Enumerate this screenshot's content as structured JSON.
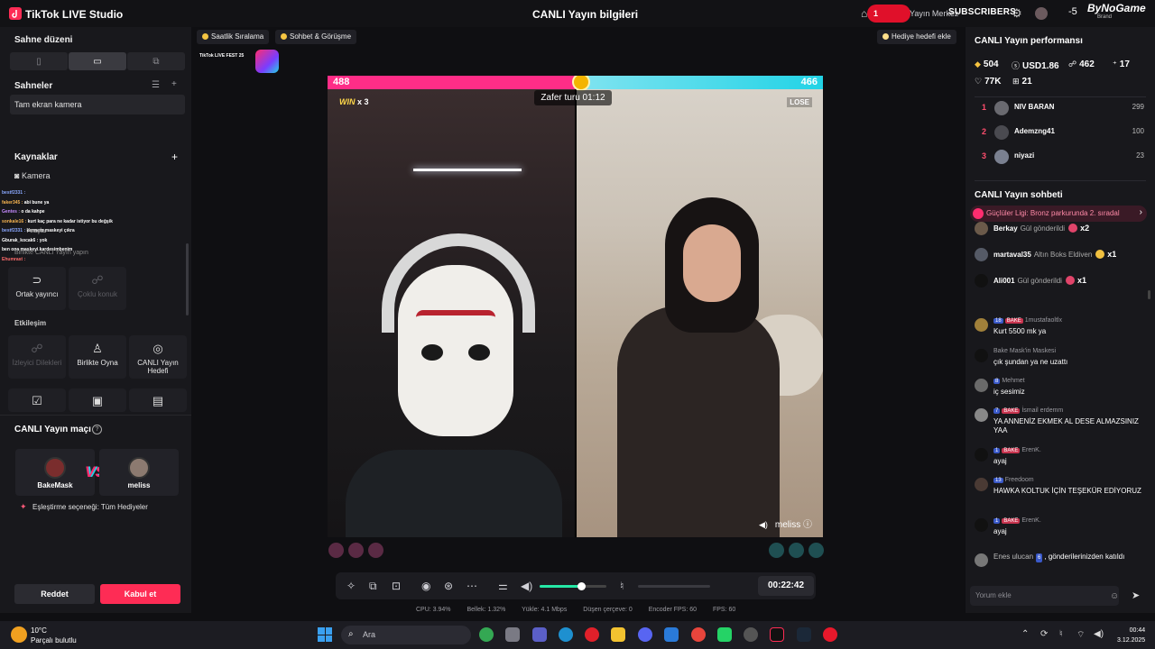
{
  "titlebar": {
    "app_name": "TikTok LIVE Studio",
    "center_title": "CANLI Yayın bilgileri",
    "red_pill_text": "1",
    "merkez_text": "Yayın Merkez",
    "subscribers_label": "SUBSCRIBERS",
    "minus_value": "-5",
    "brand": "ByNoGame",
    "brand_sub": "Brand"
  },
  "left": {
    "scene_layout_title": "Sahne düzeni",
    "scenes_title": "Sahneler",
    "scene_item": "Tam ekran kamera",
    "sources_title": "Kaynaklar",
    "source_camera": "Kamera",
    "chat_overlay": [
      {
        "name": "bestf2331 :",
        "text": "",
        "cls": "n1"
      },
      {
        "name": "faker345 :",
        "text": "abi bune ya",
        "cls": "n2"
      },
      {
        "name": "Gentes :",
        "text": "o da kahpe",
        "cls": "n3"
      },
      {
        "name": "sonkale16 :",
        "text": "kurt kaç para ne kadar istiyor bu değşik",
        "cls": "n2"
      },
      {
        "name": "bestf2331 :",
        "text": "kennem maskeyi çıkra",
        "cls": "n1"
      },
      {
        "name": "Gburak_kocak6 :",
        "text": "yok",
        "cls": ""
      },
      {
        "name": "",
        "text": "ben ona maskeyi kardesimbenim",
        "cls": ""
      },
      {
        "name": "Ehumrast :",
        "text": "",
        "cls": "n4"
      }
    ],
    "araclar_partial": "Araçlar",
    "canli_ile_partial": "Birlikte CANLI Yayın yapın",
    "tiles_row1": [
      {
        "icon": "link-icon",
        "glyph": "⊃",
        "label": "Ortak yayıncı",
        "dim": false
      },
      {
        "icon": "group-icon",
        "glyph": "☍",
        "label": "Çoklu konuk",
        "dim": true
      }
    ],
    "interaction_title": "Etkileşim",
    "tiles_row2": [
      {
        "icon": "viewer-list-icon",
        "glyph": "☍",
        "label": "İzleyici Dilekleri",
        "dim": true
      },
      {
        "icon": "play-together-icon",
        "glyph": "♙",
        "label": "Birlikte Oyna",
        "dim": false
      },
      {
        "icon": "goal-icon",
        "glyph": "◎",
        "label": "CANLI Yayın Hedefi",
        "dim": false
      }
    ],
    "tiles_row3_glyphs": [
      "☑",
      "▣",
      "▤"
    ],
    "match": {
      "title": "CANLI Yayın maçı",
      "player1": "BakeMask",
      "player2": "meliss",
      "vs": "VS",
      "pref": "Eşleştirme seçeneği: Tüm Hediyeler",
      "reject": "Reddet",
      "accept": "Kabul et"
    }
  },
  "center": {
    "chip1": "Saatlik Sıralama",
    "chip2": "Sohbet & Görüşme",
    "chip3": "Hediye hedefi ekle",
    "livefest": "TikTok LIVE FEST 25",
    "score_left": "488",
    "score_right": "466",
    "win_label": "WIN",
    "win_count": "x 3",
    "lose_label": "LOSE",
    "timer": "Zafer turu 01:12",
    "opponent_name": "meliss",
    "elapsed": "00:22:42",
    "volume_level": 0.62,
    "stats": {
      "cpu": "CPU:  3.94%",
      "bellek": "Bellek:  1.32%",
      "yukle": "Yükle:  4.1 Mbps",
      "dusen": "Düşen çerçeve:  0",
      "encoder": "Encoder FPS:  60",
      "fps": "FPS:  60"
    }
  },
  "right": {
    "perf_title": "CANLI Yayın performansı",
    "coins": "504",
    "usd": "USD1.86",
    "viewers": "462",
    "shares": "17",
    "likes": "77K",
    "gifts": "21",
    "ranking": [
      {
        "no": "1",
        "name": "NIV BARAN",
        "score": "299"
      },
      {
        "no": "2",
        "name": "Ademzng41",
        "score": "100"
      },
      {
        "no": "3",
        "name": "niyazi",
        "score": "23"
      }
    ],
    "chat_title": "CANLI Yayın sohbeti",
    "league": "Güçlüler Ligi: Bronz parkurunda 2. sıradal",
    "gift_rows": [
      {
        "name": "Berkay",
        "action": "Gül gönderildi",
        "count": "x2"
      },
      {
        "name": "martaval35",
        "action": "Altın Boks Eldiven",
        "count": "x1"
      },
      {
        "name": "Ali001",
        "action": "Gül gönderildi",
        "count": "x1"
      }
    ],
    "messages": [
      {
        "level": "18",
        "fan": "BAKE",
        "user": "1mustafaoltlx",
        "text": "Kurt 5500 mk ya"
      },
      {
        "level": "",
        "fan": "",
        "user": "Bake Mask'in Maskesi",
        "text": "çık şundan ya ne uzattı"
      },
      {
        "level": "8",
        "fan": "",
        "user": "Mehmet",
        "text": "iç sesimiz"
      },
      {
        "level": "7",
        "fan": "BAKE",
        "user": "İsmail erdemm",
        "text": "YA ANNENİZ EKMEK AL DESE ALMAZSINIZ YAA"
      },
      {
        "level": "1",
        "fan": "BAKE",
        "user": "ErenK.",
        "text": "ayaj"
      },
      {
        "level": "13",
        "fan": "",
        "user": "Freedoom",
        "text": "HAWKA KOLTUK İÇİN TEŞEKÜR EDİYORUZ"
      },
      {
        "level": "1",
        "fan": "BAKE",
        "user": "ErenK.",
        "text": "ayaj"
      },
      {
        "level": "6",
        "fan": "",
        "user": "Enes ulucan",
        "text": ", gönderilerinizden katıldı"
      }
    ],
    "comment_placeholder": "Yorum ekle"
  },
  "taskbar": {
    "temp": "10°C",
    "weather": "Parçalı bulutlu",
    "search": "Ara",
    "time": "00:44",
    "date": "3.12.2025"
  }
}
